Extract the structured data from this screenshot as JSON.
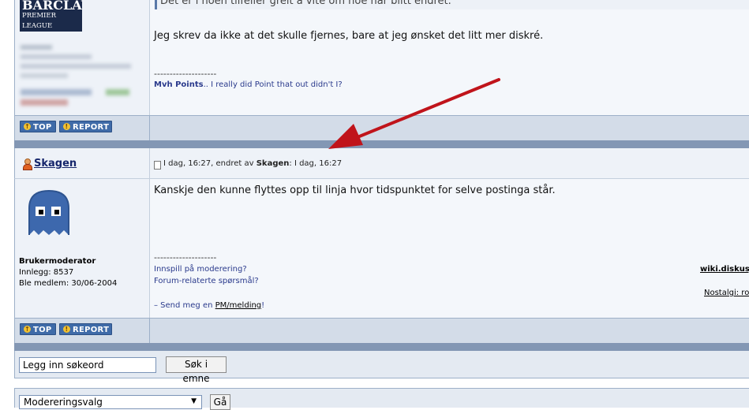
{
  "post1": {
    "logo_line1": "BARCLAYS",
    "logo_line2": "PREMIER LEAGUE",
    "quote": "Det er i noen tilfeller greit å vite om noe har blitt endret.",
    "message": "Jeg skrev da ikke at det skulle fjernes, bare at jeg ønsket det litt mer diskré.",
    "sig_divider": "--------------------",
    "sig_bold": "Mvh Points",
    "sig_rest": ".. I really did Point that out didn't I?"
  },
  "buttons": {
    "top": "TOP",
    "report": "REPORT"
  },
  "post2": {
    "username": "Skagen",
    "time": "I dag, 16:27",
    "edited_by_prefix": ", endret av ",
    "edited_by_user": "Skagen",
    "edited_time": ": I dag, 16:27",
    "message": "Kanskje den kunne flyttes opp til linja hvor tidspunktet for selve postinga står.",
    "role": "Brukermoderator",
    "posts": "Innlegg: 8537",
    "member_since": "Ble medlem: 30/06-2004",
    "sig_divider": "--------------------",
    "sig_line1": "Innspill på moderering?",
    "sig_line2": "Forum-relaterte spørsmål?",
    "sig_line3_prefix": "– Send meg en ",
    "sig_line3_link": "PM/melding",
    "sig_line3_suffix": "!",
    "right_link1": "wiki.diskusj",
    "right_link2": "Nostalgi: roy"
  },
  "search": {
    "value": "Legg inn søkeord",
    "button": "Søk i emne"
  },
  "moderation": {
    "select_value": "Modereringsvalg",
    "go": "Gå"
  },
  "colors": {
    "arrow": "#c0141b",
    "separator": "#8397b4",
    "button": "#3f6ba8"
  }
}
